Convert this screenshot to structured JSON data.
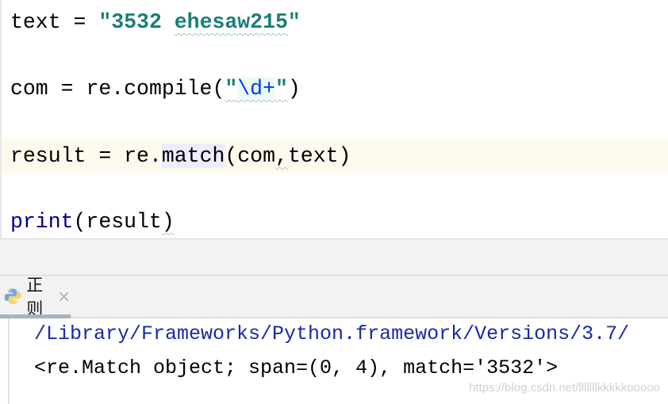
{
  "editor": {
    "lines": {
      "l1": {
        "var": "text",
        "op": " = ",
        "str": "\"3532 ",
        "str_typo": "ehesaw215",
        "str_end": "\""
      },
      "l2": {
        "var": "com",
        "op": " = ",
        "call": "re.compile(",
        "q1": "\"",
        "regex": "\\d+",
        "q2": "\"",
        "close": ")"
      },
      "l3": {
        "var": "result",
        "op": " = ",
        "mod": "re.",
        "fn": "match",
        "args_a": "(com",
        "comma": ",",
        "args_b": "text)"
      },
      "l4": {
        "fn": "print",
        "args": "(result",
        "close": ")"
      }
    }
  },
  "run_tab": {
    "label": "正则",
    "icon": "python-icon",
    "close": "×"
  },
  "console": {
    "path": "/Library/Frameworks/Python.framework/Versions/3.7/",
    "output": "<re.Match object; span=(0, 4), match='3532'>"
  },
  "watermark": "https://blog.csdn.net/lllllllkkkkkooooo",
  "colors": {
    "string": "#1a7f75",
    "regex": "#0037ff",
    "builtin": "#000080",
    "current_line": "#fcfaed"
  }
}
